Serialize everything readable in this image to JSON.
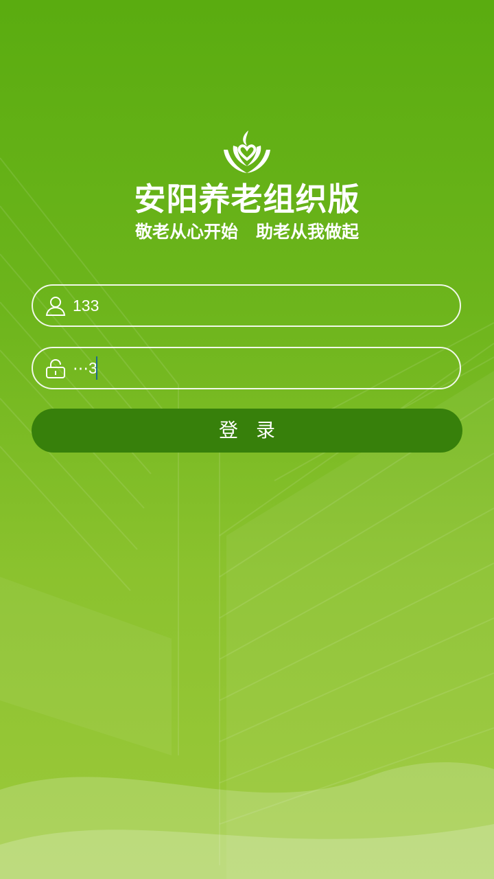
{
  "app": {
    "title": "安阳养老组织版",
    "slogan": "敬老从心开始   助老从我做起"
  },
  "logo": {
    "icon": "heart-hands-logo-icon"
  },
  "form": {
    "username": {
      "icon": "user-icon",
      "value": "133"
    },
    "password": {
      "icon": "lock-icon",
      "value": "⋯3"
    },
    "login_label": "登录"
  },
  "colors": {
    "accent": "#37800b",
    "background_top": "#5aac10",
    "background_bottom": "#9cc93b",
    "text": "#ffffff"
  }
}
